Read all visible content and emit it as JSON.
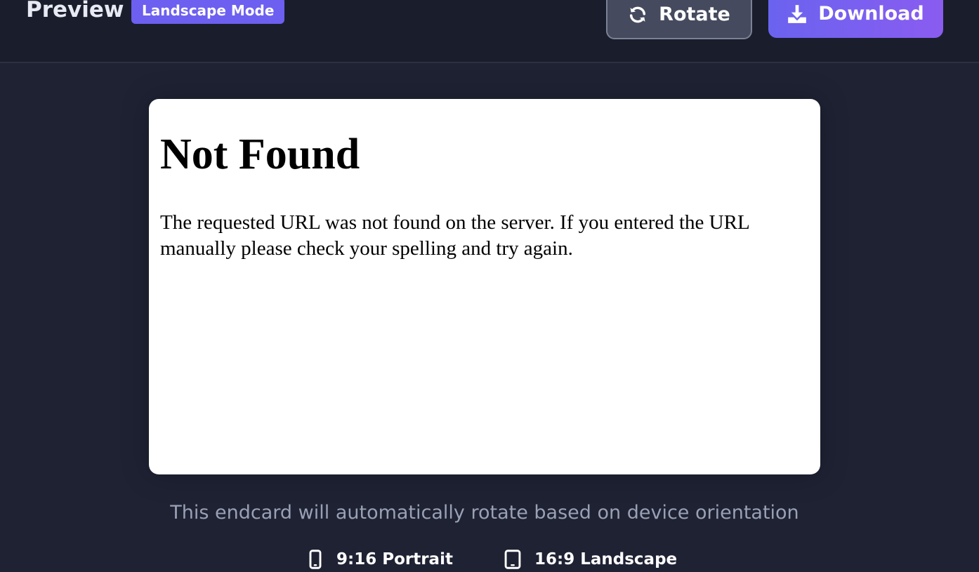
{
  "header": {
    "title": "Preview",
    "mode_badge": "Landscape Mode",
    "rotate_label": "Rotate",
    "download_label": "Download"
  },
  "preview": {
    "heading": "Not Found",
    "message": "The requested URL was not found on the server. If you entered the URL manually please check your spelling and try again."
  },
  "footer": {
    "caption": "This endcard will automatically rotate based on device orientation",
    "orientations": [
      {
        "label": "9:16 Portrait",
        "icon": "mobile-phone-icon"
      },
      {
        "label": "16:9 Landscape",
        "icon": "tablet-icon"
      }
    ]
  },
  "colors": {
    "background": "#1e2233",
    "header": "#1a1e2c",
    "accent": "#6d5ff0",
    "rotate_button": "#454a5e"
  }
}
